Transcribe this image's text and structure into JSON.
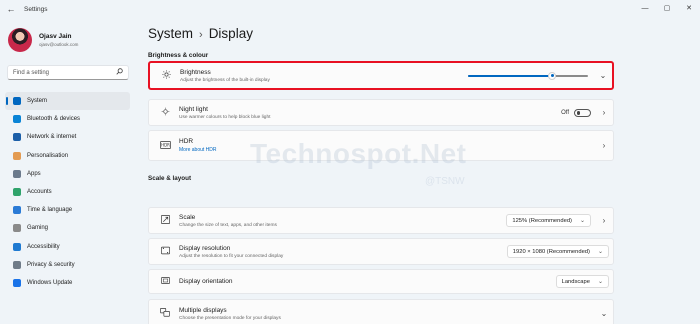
{
  "window": {
    "back_glyph": "←",
    "title": "Settings",
    "controls": {
      "minimize": "—",
      "maximize": "▢",
      "close": "✕"
    }
  },
  "user": {
    "name": "Ojasv Jain",
    "email": "ojasv@outlook.com"
  },
  "search": {
    "placeholder": "Find a setting",
    "icon": "search-icon"
  },
  "nav": [
    {
      "label": "System",
      "icon": "monitor-icon",
      "color": "#0067c0",
      "active": true
    },
    {
      "label": "Bluetooth & devices",
      "icon": "bluetooth-icon",
      "color": "#0a84d6"
    },
    {
      "label": "Network & internet",
      "icon": "wifi-icon",
      "color": "#1c5fa8"
    },
    {
      "label": "Personalisation",
      "icon": "brush-icon",
      "color": "#e39b52"
    },
    {
      "label": "Apps",
      "icon": "apps-icon",
      "color": "#6b7a8c"
    },
    {
      "label": "Accounts",
      "icon": "person-icon",
      "color": "#2fa36b"
    },
    {
      "label": "Time & language",
      "icon": "globe-clock-icon",
      "color": "#2b7bd6"
    },
    {
      "label": "Gaming",
      "icon": "gamepad-icon",
      "color": "#8a8a8a"
    },
    {
      "label": "Accessibility",
      "icon": "accessibility-icon",
      "color": "#1f7ad1"
    },
    {
      "label": "Privacy & security",
      "icon": "shield-icon",
      "color": "#6f7b88"
    },
    {
      "label": "Windows Update",
      "icon": "update-icon",
      "color": "#1a73e8"
    }
  ],
  "breadcrumb": {
    "parent": "System",
    "separator": "›",
    "current": "Display"
  },
  "sections": {
    "brightness": "Brightness & colour",
    "scale_layout": "Scale & layout"
  },
  "cards": {
    "brightness": {
      "title": "Brightness",
      "subtitle": "Adjust the brightness of the built-in display",
      "value": 0.7,
      "icon": "sun-icon"
    },
    "night_light": {
      "title": "Night light",
      "subtitle": "Use warmer colours to help block blue light",
      "state": "Off",
      "icon": "sun-dim-icon"
    },
    "hdr": {
      "title": "HDR",
      "link": "More about HDR",
      "icon": "hdr-icon"
    },
    "scale": {
      "title": "Scale",
      "subtitle": "Change the size of text, apps, and other items",
      "value": "125% (Recommended)",
      "icon": "scale-icon"
    },
    "resolution": {
      "title": "Display resolution",
      "subtitle": "Adjust the resolution to fit your connected display",
      "value": "1920 × 1080 (Recommended)",
      "icon": "resolution-icon"
    },
    "orientation": {
      "title": "Display orientation",
      "value": "Landscape",
      "icon": "orientation-icon"
    },
    "multiple": {
      "title": "Multiple displays",
      "subtitle": "Choose the presentation mode for your displays",
      "icon": "multi-display-icon"
    }
  },
  "watermark": {
    "brand": "Technospot.Net",
    "handle": "@TSNW"
  },
  "colors": {
    "accent": "#0067c0",
    "highlight": "#e81123"
  }
}
